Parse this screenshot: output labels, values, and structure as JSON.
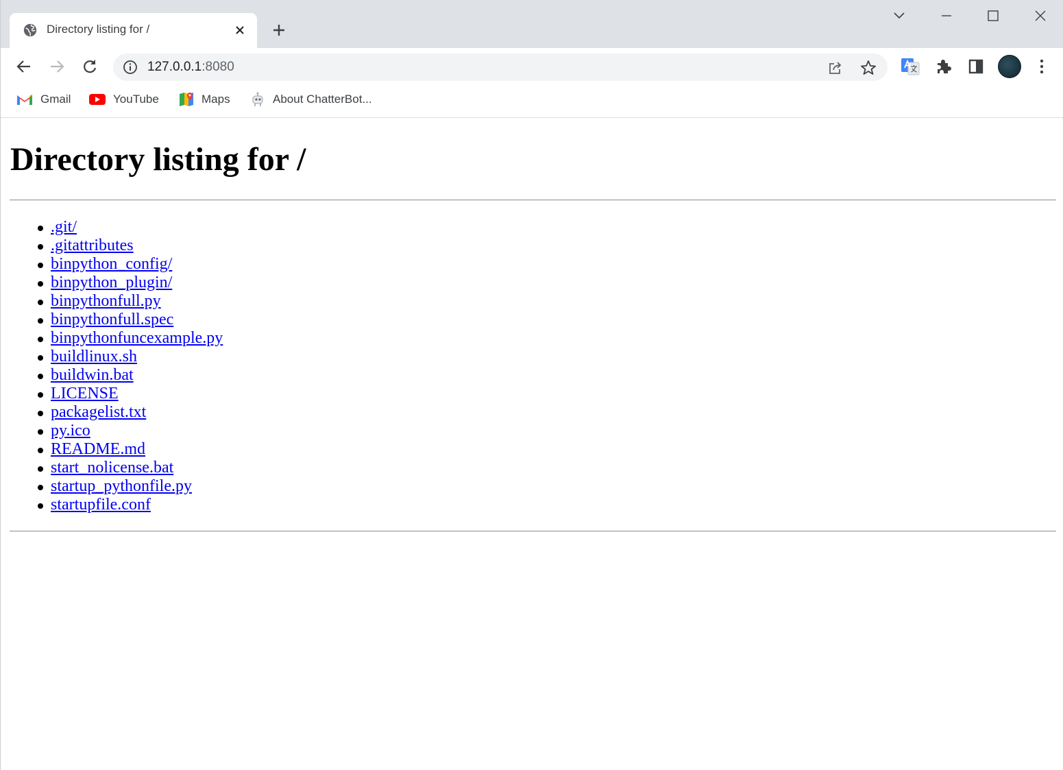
{
  "browser": {
    "tab": {
      "title": "Directory listing for /",
      "favicon": "globe-icon"
    },
    "omnibox": {
      "host": "127.0.0.1",
      "port": ":8080"
    },
    "bookmarks": [
      {
        "label": "Gmail",
        "icon": "gmail-icon"
      },
      {
        "label": "YouTube",
        "icon": "youtube-icon"
      },
      {
        "label": "Maps",
        "icon": "maps-icon"
      },
      {
        "label": "About ChatterBot...",
        "icon": "chatterbot-icon"
      }
    ]
  },
  "page": {
    "heading": "Directory listing for /",
    "files": [
      ".git/",
      ".gitattributes",
      "binpython_config/",
      "binpython_plugin/",
      "binpythonfull.py",
      "binpythonfull.spec",
      "binpythonfuncexample.py",
      "buildlinux.sh",
      "buildwin.bat",
      "LICENSE",
      "packagelist.txt",
      "py.ico",
      "README.md",
      "start_nolicense.bat",
      "startup_pythonfile.py",
      "startupfile.conf"
    ]
  },
  "colors": {
    "link": "#0000ee",
    "tabstrip": "#dee1e6",
    "omnibox": "#f1f3f4"
  }
}
